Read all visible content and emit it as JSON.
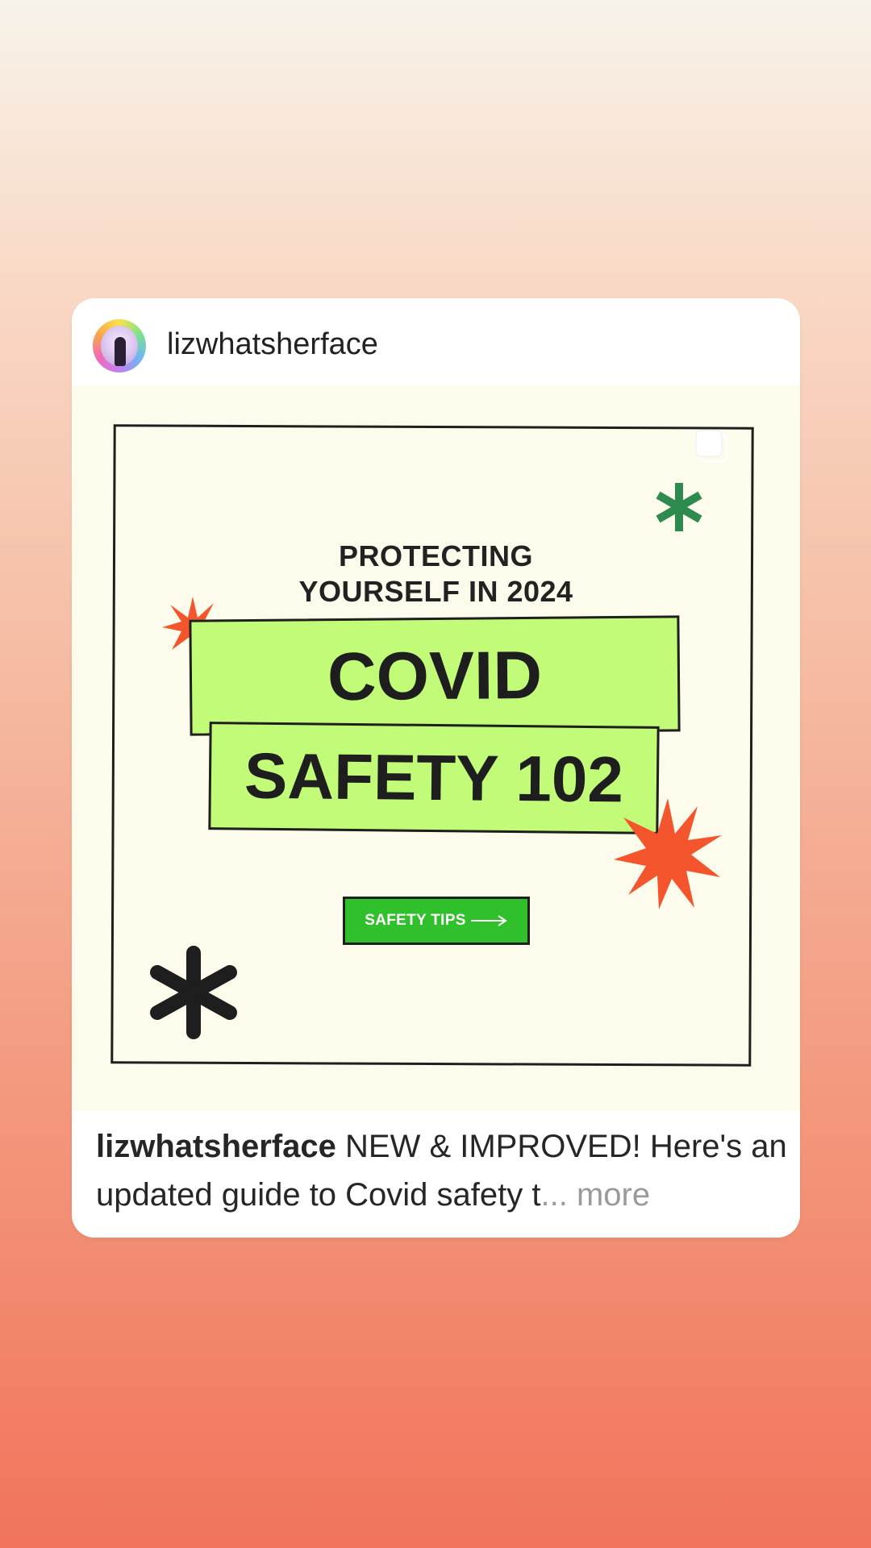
{
  "post": {
    "username": "lizwhatsherface",
    "avatar_icon": "profile-photo",
    "image": {
      "subtitle_line1": "PROTECTING",
      "subtitle_line2": "YOURSELF IN 2024",
      "title_line1": "COVID",
      "title_line2": "SAFETY 102",
      "button_label": "SAFETY TIPS",
      "button_icon": "arrow-right-icon",
      "multi_image_icon": "carousel-icon"
    },
    "caption": {
      "username": "lizwhatsherface",
      "text": "NEW & IMPROVED! Here's an updated guide to Covid safety t",
      "ellipsis": "...",
      "more_label": "more"
    }
  },
  "colors": {
    "banner_green": "#c1fb78",
    "button_green": "#2fc02c",
    "star_red": "#f4552c",
    "asterisk_green": "#2e8b4f",
    "post_background": "#fdfbec"
  }
}
